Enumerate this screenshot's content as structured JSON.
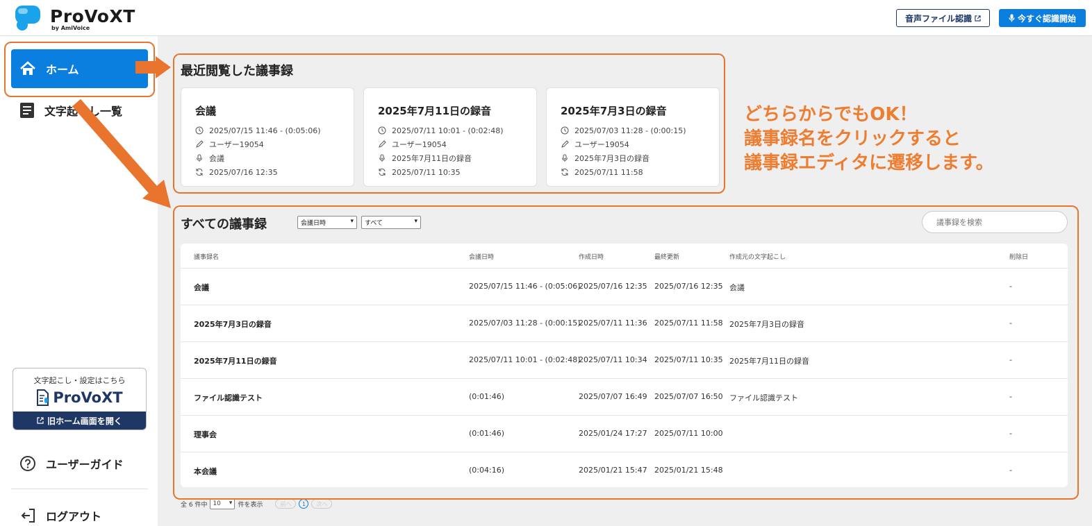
{
  "header": {
    "logo_text": "ProVoXT",
    "logo_sub": "by AmiVoice",
    "file_button": "音声ファイル認識",
    "start_button": "今すぐ認識開始"
  },
  "sidebar": {
    "home": "ホーム",
    "transcripts": "文字起こし一覧",
    "promo_top": "文字起こし・設定はこちら",
    "promo_logo": "ProVoXT",
    "promo_button": "旧ホーム画面を開く",
    "guide": "ユーザーガイド",
    "logout": "ログアウト"
  },
  "recent": {
    "title": "最近閲覧した議事録",
    "cards": [
      {
        "title": "会議",
        "datetime": "2025/07/15 11:46 - (0:05:06)",
        "user": "ユーザー19054",
        "source": "会議",
        "updated": "2025/07/16 12:35"
      },
      {
        "title": "2025年7月11日の録音",
        "datetime": "2025/07/11 10:01 - (0:02:48)",
        "user": "ユーザー19054",
        "source": "2025年7月11日の録音",
        "updated": "2025/07/11 10:35"
      },
      {
        "title": "2025年7月3日の録音",
        "datetime": "2025/07/03 11:28 - (0:00:15)",
        "user": "ユーザー19054",
        "source": "2025年7月3日の録音",
        "updated": "2025/07/11 11:58"
      }
    ]
  },
  "all": {
    "title": "すべての議事録",
    "sort_select": "会議日時",
    "filter_select": "すべて",
    "search_placeholder": "議事録を検索",
    "columns": [
      "議事録名",
      "会議日時",
      "作成日時",
      "最終更新",
      "作成元の文字起こし",
      "削除日"
    ],
    "rows": [
      [
        "会議",
        "2025/07/15 11:46 - (0:05:06)",
        "2025/07/16 12:35",
        "2025/07/16 12:35",
        "会議",
        "-"
      ],
      [
        "2025年7月3日の録音",
        "2025/07/03 11:28 - (0:00:15)",
        "2025/07/11 11:36",
        "2025/07/11 11:58",
        "2025年7月3日の録音",
        "-"
      ],
      [
        "2025年7月11日の録音",
        "2025/07/11 10:01 - (0:02:48)",
        "2025/07/11 10:34",
        "2025/07/11 10:35",
        "2025年7月11日の録音",
        "-"
      ],
      [
        "ファイル認識テスト",
        "(0:01:46)",
        "2025/07/07 16:49",
        "2025/07/07 16:50",
        "ファイル認識テスト",
        "-"
      ],
      [
        "理事会",
        "(0:01:46)",
        "2025/01/24 17:27",
        "2025/07/11 10:00",
        "",
        "-"
      ],
      [
        "本会議",
        "(0:04:16)",
        "2025/01/21 15:47",
        "2025/01/21 15:48",
        "",
        "-"
      ]
    ]
  },
  "pager": {
    "total": "全 6 件中",
    "per_page": "10",
    "per_page_suffix": "件を表示",
    "prev": "前へ",
    "page": "1",
    "next": "次へ"
  },
  "annotation": {
    "line1": "どちらからでもOK！",
    "line2": "議事録名をクリックすると",
    "line3": "議事録エディタに遷移します。"
  },
  "colors": {
    "primary": "#0a7fe0",
    "navy": "#1f3764",
    "annotation": "#ed7d31"
  }
}
